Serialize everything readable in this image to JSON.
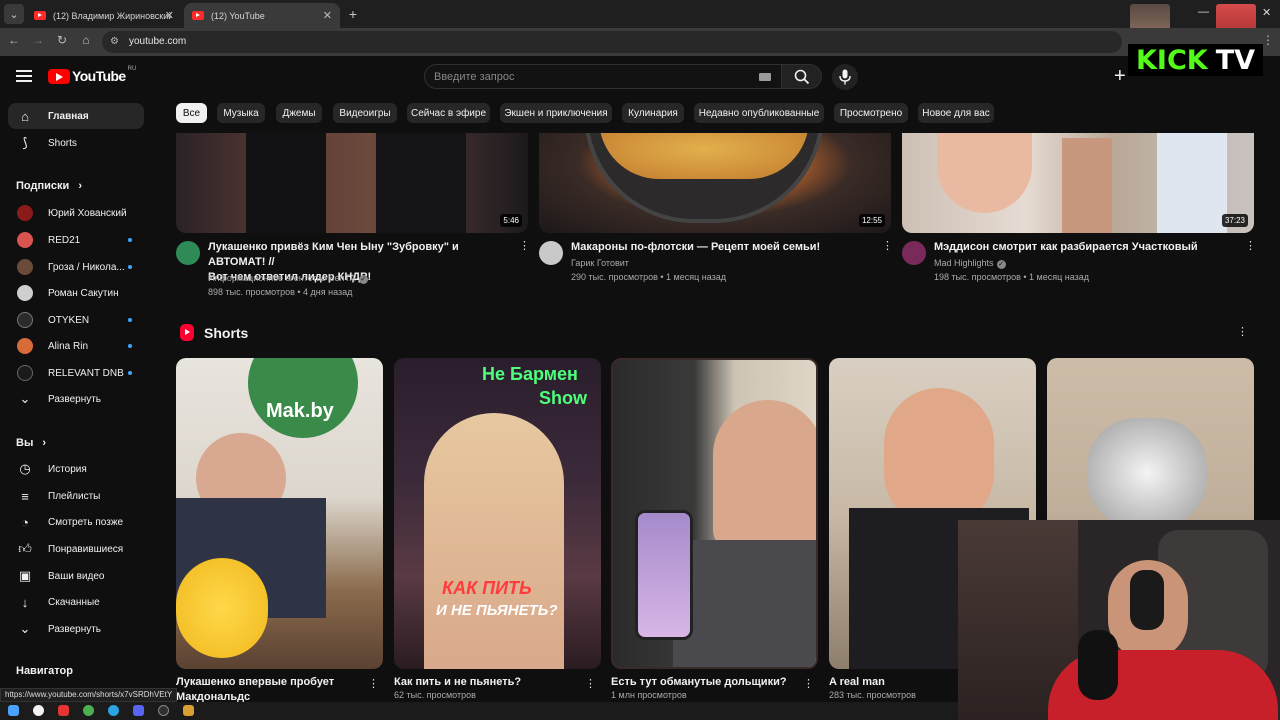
{
  "browser": {
    "tabs": [
      {
        "title": "(12) Владимир Жириновский",
        "active": false
      },
      {
        "title": "(12) YouTube",
        "active": true
      }
    ],
    "new_tab": "+",
    "url": "youtube.com"
  },
  "header": {
    "logo_text": "YouTube",
    "region": "RU",
    "search_placeholder": "Введите запрос"
  },
  "overlay": {
    "kick": "KICK",
    "tv": "TV"
  },
  "sidebar": {
    "main": [
      {
        "label": "Главная",
        "icon": "home-icon",
        "active": true
      },
      {
        "label": "Shorts",
        "icon": "shorts-icon",
        "active": false
      }
    ],
    "subscriptions_heading": "Подписки",
    "subscriptions": [
      {
        "label": "Юрий Хованский",
        "color": "#8b1a1a",
        "live": false
      },
      {
        "label": "RED21",
        "color": "#d9534f",
        "live": true
      },
      {
        "label": "Гроза / Никола...",
        "color": "#6b4a3a",
        "live": true
      },
      {
        "label": "Роман Сакутин",
        "color": "#cfcfcf",
        "live": false
      },
      {
        "label": "OTYKEN",
        "color": "#2b2b2b",
        "live": true
      },
      {
        "label": "Alina Rin",
        "color": "#d96b3a",
        "live": true
      },
      {
        "label": "RELEVANT DNB",
        "color": "#1a1a1a",
        "live": true
      }
    ],
    "expand_label": "Развернуть",
    "you_heading": "Вы",
    "you_items": [
      {
        "label": "История",
        "icon": "history-icon"
      },
      {
        "label": "Плейлисты",
        "icon": "playlists-icon"
      },
      {
        "label": "Смотреть позже",
        "icon": "watch-later-icon"
      },
      {
        "label": "Понравившиеся",
        "icon": "like-icon"
      },
      {
        "label": "Ваши видео",
        "icon": "your-videos-icon"
      },
      {
        "label": "Скачанные",
        "icon": "download-icon"
      },
      {
        "label": "Развернуть",
        "icon": "chevron-down-icon"
      }
    ],
    "navigator_heading": "Навигатор"
  },
  "chips": [
    "Все",
    "Музыка",
    "Джемы",
    "Видеоигры",
    "Сейчас в эфире",
    "Экшен и приключения",
    "Кулинария",
    "Недавно опубликованные",
    "Просмотрено",
    "Новое для вас"
  ],
  "videos": [
    {
      "title_line1": "Лукашенко привёз Ким Чен Ыну \"Зубровку\" и АВТОМАТ! //",
      "title_line2": "Вот чем ответил лидер КНДР!",
      "channel": "Информационное агентство БелТА",
      "stats": "898 тыс. просмотров • 4 дня назад",
      "duration": "5:46",
      "avatar_color": "#2e8b57"
    },
    {
      "title_line1": "Макароны по-флотски — Рецепт моей семьи!",
      "title_line2": "",
      "channel": "Гарик Готовит",
      "stats": "290 тыс. просмотров • 1 месяц назад",
      "duration": "12:55",
      "avatar_color": "#c9c9c9"
    },
    {
      "title_line1": "Мэддисон смотрит как разбирается Участковый",
      "title_line2": "",
      "channel": "Mad Highlights",
      "stats": "198 тыс. просмотров • 1 месяц назад",
      "duration": "37:23",
      "avatar_color": "#7a2a5a"
    }
  ],
  "shorts": {
    "heading": "Shorts",
    "items": [
      {
        "title_line1": "Лукашенко впервые пробует",
        "title_line2": "Макдональдс",
        "meta": ""
      },
      {
        "title_line1": "Как пить и не пьянеть?",
        "title_line2": "",
        "meta": "62 тыс. просмотров"
      },
      {
        "title_line1": "Есть тут обманутые дольщики?",
        "title_line2": "",
        "meta": "1 млн просмотров"
      },
      {
        "title_line1": "A real man",
        "title_line2": "",
        "meta": "283 тыс. просмотров"
      }
    ],
    "thumb_texts": {
      "makby": "Mak.by",
      "barmen": "Не Бармен",
      "show": "Show",
      "kak_pit": "КАК ПИТЬ",
      "ne_pyanet": "И НЕ ПЬЯНЕТЬ?"
    }
  },
  "status_url": "https://www.youtube.com/shorts/x7vSRDhVEtY"
}
